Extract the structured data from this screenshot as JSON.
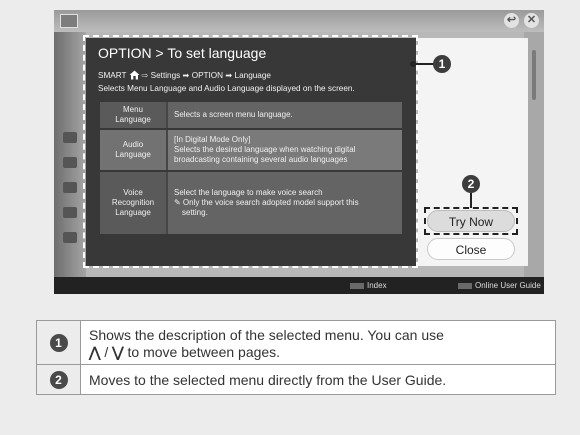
{
  "dialog": {
    "title": "OPTION > To set language",
    "path": {
      "smart": "SMART",
      "arrow1": "⇨",
      "settings": "Settings",
      "arrow2": "➡",
      "option": "OPTION",
      "arrow3": "➡",
      "language": "Language"
    },
    "description": "Selects Menu Language and Audio Language displayed on the screen.",
    "rows": [
      {
        "label_lines": [
          "Menu",
          "Language"
        ],
        "value_lines": [
          "Selects a screen menu language."
        ]
      },
      {
        "label_lines": [
          "Audio",
          "Language"
        ],
        "value_lines": [
          "[In Digital Mode Only]",
          "Selects the desired language when watching digital",
          "broadcasting containing several audio languages"
        ]
      },
      {
        "label_lines": [
          "Voice",
          "Recognition",
          "Language"
        ],
        "value_lines": [
          "Select the language to make voice search",
          "✎ Only the voice search adopted model support this",
          "setting."
        ]
      }
    ]
  },
  "panel": {
    "try_now": "Try Now",
    "close": "Close"
  },
  "callouts": {
    "one": "1",
    "two": "2"
  },
  "bottom_bar": {
    "index": "Index",
    "online_guide": "Online User Guide"
  },
  "corner_buttons": {
    "back": "↩",
    "close": "✕"
  },
  "legend": [
    {
      "num": "1",
      "text_a": "Shows the description of the selected menu. You can use",
      "up_glyph": "⋀",
      "sep": "/",
      "down_glyph": "⋁",
      "text_b": "to move between pages."
    },
    {
      "num": "2",
      "text": "Moves to the selected menu directly from the User Guide."
    }
  ],
  "icons": [
    "home-icon",
    "up-arrow-icon",
    "down-arrow-icon",
    "back-icon",
    "close-icon",
    "pencil-note-icon"
  ]
}
